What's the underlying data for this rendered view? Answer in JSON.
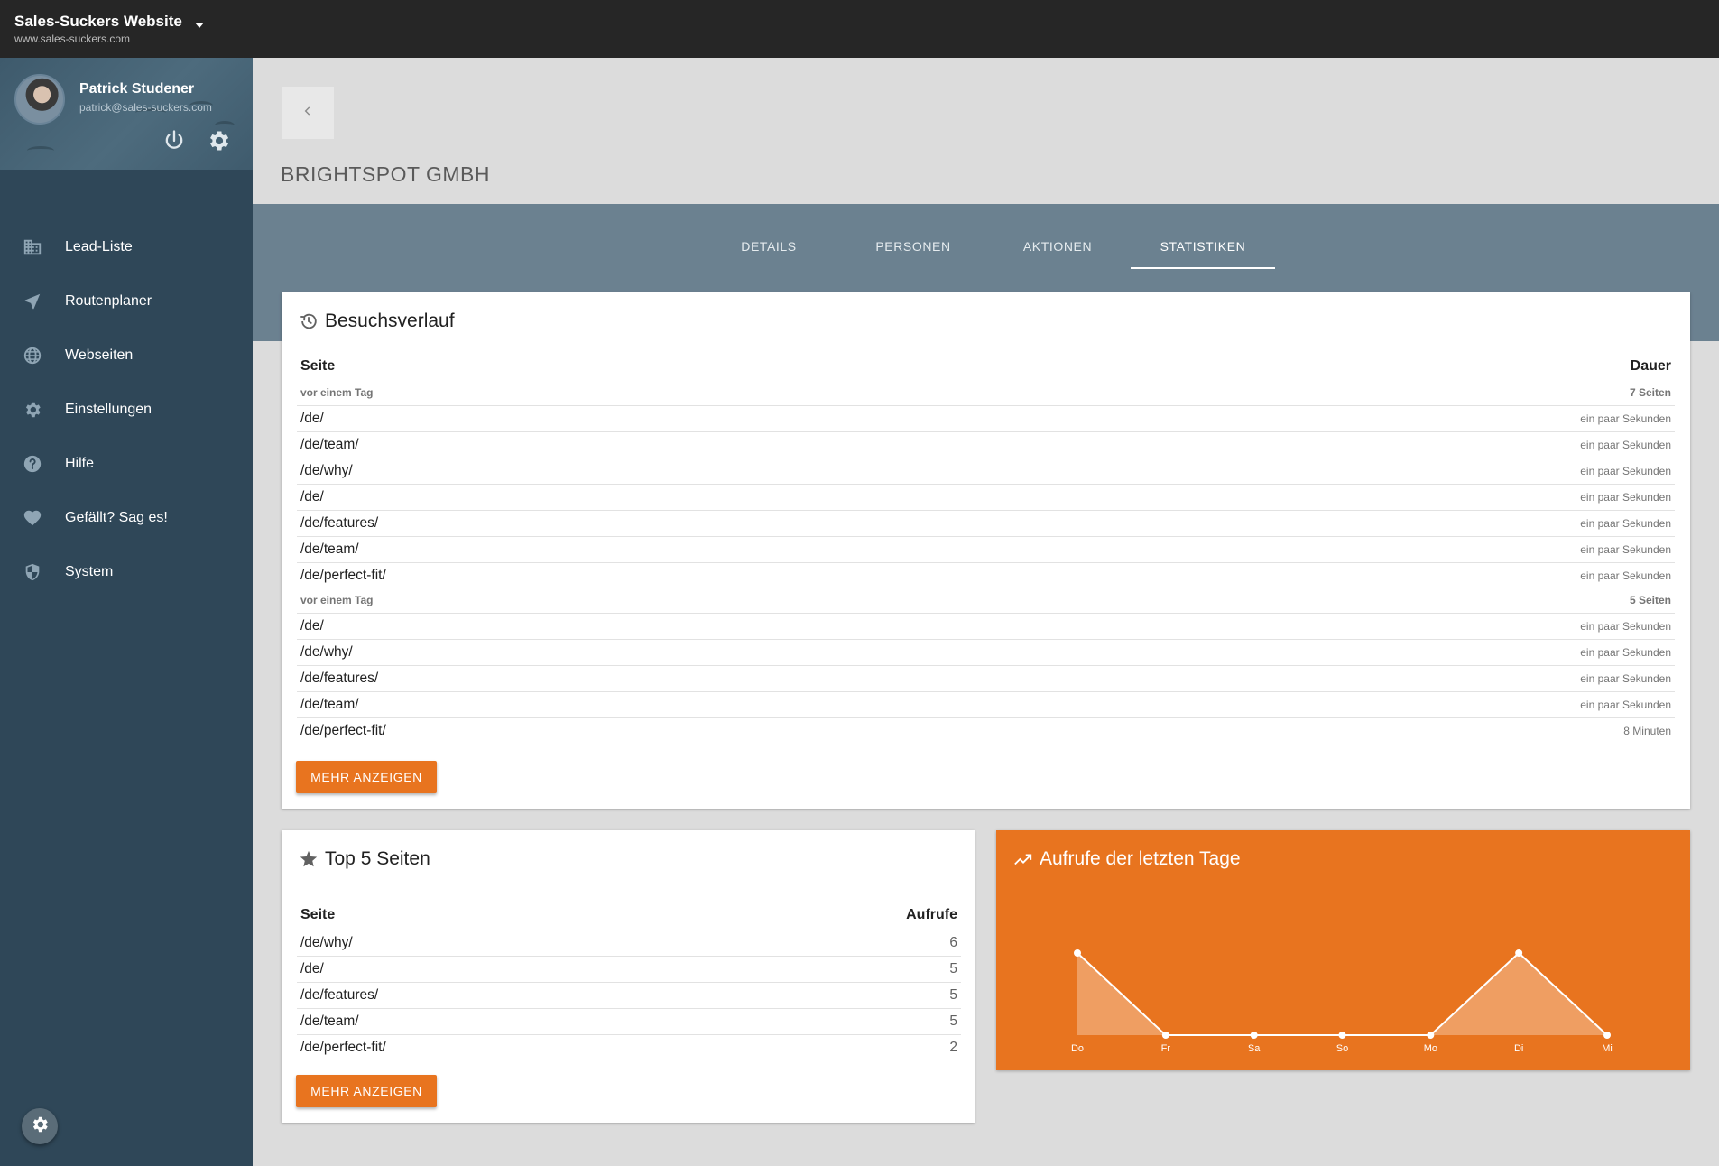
{
  "topbar": {
    "site_name": "Sales-Suckers Website",
    "site_url": "www.sales-suckers.com"
  },
  "profile": {
    "name": "Patrick Studener",
    "email": "patrick@sales-suckers.com"
  },
  "nav": [
    {
      "label": "Lead-Liste",
      "icon": "building-icon"
    },
    {
      "label": "Routenplaner",
      "icon": "navigation-icon"
    },
    {
      "label": "Webseiten",
      "icon": "globe-icon"
    },
    {
      "label": "Einstellungen",
      "icon": "gear-icon"
    },
    {
      "label": "Hilfe",
      "icon": "help-icon"
    },
    {
      "label": "Gefällt? Sag es!",
      "icon": "heart-icon"
    },
    {
      "label": "System",
      "icon": "shield-icon"
    }
  ],
  "company": "BRIGHTSPOT GMBH",
  "tabs": [
    "DETAILS",
    "PERSONEN",
    "AKTIONEN",
    "STATISTIKEN"
  ],
  "active_tab": "STATISTIKEN",
  "visits": {
    "title": "Besuchsverlauf",
    "col_page": "Seite",
    "col_duration": "Dauer",
    "groups": [
      {
        "when": "vor einem Tag",
        "count": "7 Seiten",
        "rows": [
          {
            "page": "/de/",
            "duration": "ein paar Sekunden"
          },
          {
            "page": "/de/team/",
            "duration": "ein paar Sekunden"
          },
          {
            "page": "/de/why/",
            "duration": "ein paar Sekunden"
          },
          {
            "page": "/de/",
            "duration": "ein paar Sekunden"
          },
          {
            "page": "/de/features/",
            "duration": "ein paar Sekunden"
          },
          {
            "page": "/de/team/",
            "duration": "ein paar Sekunden"
          },
          {
            "page": "/de/perfect-fit/",
            "duration": "ein paar Sekunden"
          }
        ]
      },
      {
        "when": "vor einem Tag",
        "count": "5 Seiten",
        "rows": [
          {
            "page": "/de/",
            "duration": "ein paar Sekunden"
          },
          {
            "page": "/de/why/",
            "duration": "ein paar Sekunden"
          },
          {
            "page": "/de/features/",
            "duration": "ein paar Sekunden"
          },
          {
            "page": "/de/team/",
            "duration": "ein paar Sekunden"
          },
          {
            "page": "/de/perfect-fit/",
            "duration": "8 Minuten"
          }
        ]
      }
    ],
    "more_label": "MEHR ANZEIGEN"
  },
  "top_pages": {
    "title": "Top 5 Seiten",
    "col_page": "Seite",
    "col_views": "Aufrufe",
    "rows": [
      {
        "page": "/de/why/",
        "views": "6"
      },
      {
        "page": "/de/",
        "views": "5"
      },
      {
        "page": "/de/features/",
        "views": "5"
      },
      {
        "page": "/de/team/",
        "views": "5"
      },
      {
        "page": "/de/perfect-fit/",
        "views": "2"
      }
    ],
    "more_label": "MEHR ANZEIGEN"
  },
  "chart_data": {
    "type": "area",
    "title": "Aufrufe der letzten Tage",
    "categories": [
      "Do",
      "Fr",
      "Sa",
      "So",
      "Mo",
      "Di",
      "Mi"
    ],
    "series": [
      {
        "values": [
          1,
          0,
          0,
          0,
          0,
          1,
          0
        ]
      }
    ],
    "ylim": [
      0,
      1
    ],
    "grid": false,
    "legend": "none"
  },
  "colors": {
    "accent": "#e8741f",
    "sidebar": "#2f4758",
    "topbar": "#262626",
    "tab_band": "#6b8190"
  }
}
